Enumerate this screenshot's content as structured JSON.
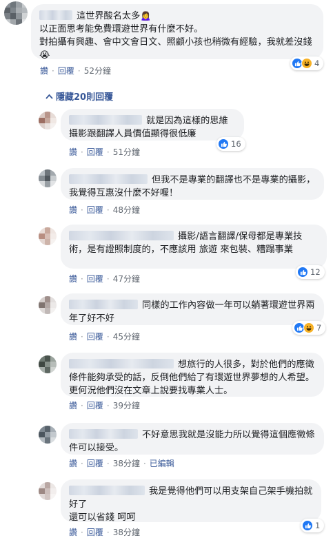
{
  "top_comment": {
    "text": "這世界酸名太多🙍‍♀️\n以正面思考能免費環遊世界有什麼不好。\n對拍攝有興趣、會中文會日文、照顧小孩也稍微有經驗，我就差沒錢😭",
    "actions": {
      "like": "讚",
      "reply": "回覆",
      "time": "52分鐘"
    },
    "reactions": {
      "count": "4",
      "types": [
        "like",
        "haha"
      ]
    }
  },
  "hide_replies_label": "隱藏20則回覆",
  "replies": [
    {
      "text": "就是因為這樣的思維\n攝影跟翻譯人員價值顯得很低廉",
      "time": "51分鐘",
      "reaction_count": "16",
      "types": [
        "like"
      ]
    },
    {
      "text": "但我不是專業的翻譯也不是專業的攝影，我覺得互惠沒什麼不好喔！",
      "time": "48分鐘"
    },
    {
      "text": "攝影/語言翻譯/保母都是專業技術，是有證照制度的，不應該用 旅遊 來包裝、糟蹋事業",
      "time": "47分鐘",
      "reaction_count": "12",
      "types": [
        "like"
      ]
    },
    {
      "text": "同樣的工作內容做一年可以躺著環遊世界兩年了好不好",
      "time": "45分鐘",
      "reaction_count": "7",
      "types": [
        "like",
        "haha"
      ]
    },
    {
      "text": "想旅行的人很多，對於他們的應徵條件能夠承受的話，反倒他們給了有環遊世界夢想的人希望。更何況他們沒在文章上說要找專業人士。",
      "time": "39分鐘"
    },
    {
      "text": "不好意思我就是沒能力所以覺得這個應徵條件可以接受。",
      "time": "38分鐘",
      "edited": "已編輯"
    },
    {
      "text": "我是覺得他們可以用支架自己架手機拍就好了\n還可以省錢 呵呵",
      "time": "38分鐘",
      "reaction_count": "1",
      "types": [
        "like"
      ]
    }
  ],
  "labels": {
    "like": "讚",
    "reply": "回覆"
  },
  "colors": {
    "link": "#385898",
    "bubble": "#f2f3f5",
    "like": "#2078f4",
    "haha": "#f7b125"
  }
}
